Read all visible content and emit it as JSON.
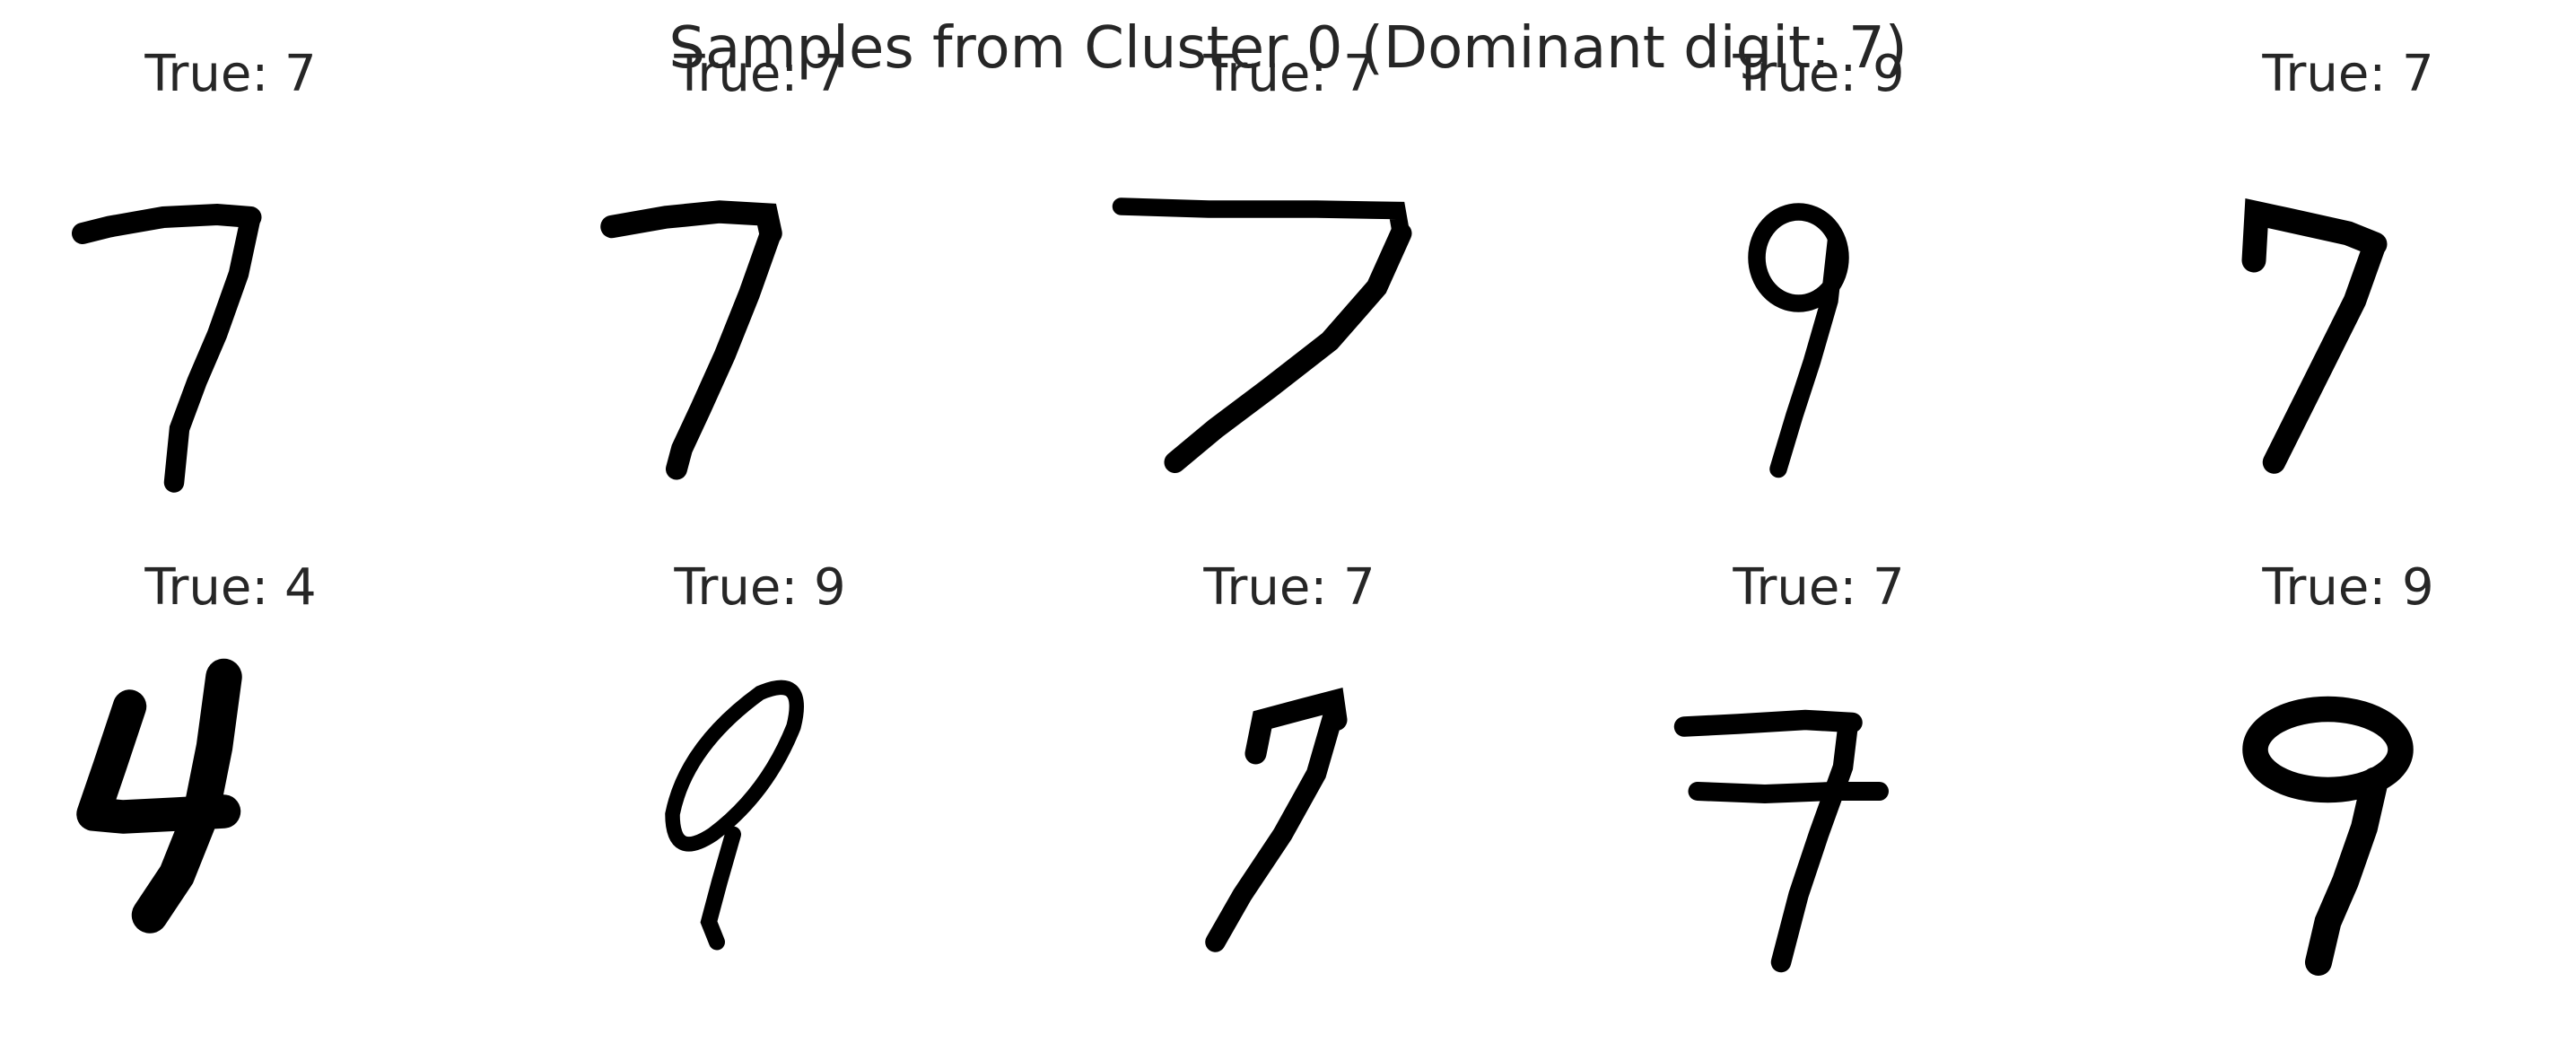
{
  "figure": {
    "title": "Samples from Cluster 0 (Dominant digit: 7)",
    "samples": [
      {
        "label": "True: 7",
        "digit": "7"
      },
      {
        "label": "True: 7",
        "digit": "7"
      },
      {
        "label": "True: 7",
        "digit": "7"
      },
      {
        "label": "True: 9",
        "digit": "9"
      },
      {
        "label": "True: 7",
        "digit": "7"
      },
      {
        "label": "True: 4",
        "digit": "4"
      },
      {
        "label": "True: 9",
        "digit": "9"
      },
      {
        "label": "True: 7",
        "digit": "7"
      },
      {
        "label": "True: 7",
        "digit": "7"
      },
      {
        "label": "True: 9",
        "digit": "9"
      }
    ],
    "colors": {
      "ink": "#000000",
      "background": "#ffffff",
      "text": "#262626"
    }
  }
}
